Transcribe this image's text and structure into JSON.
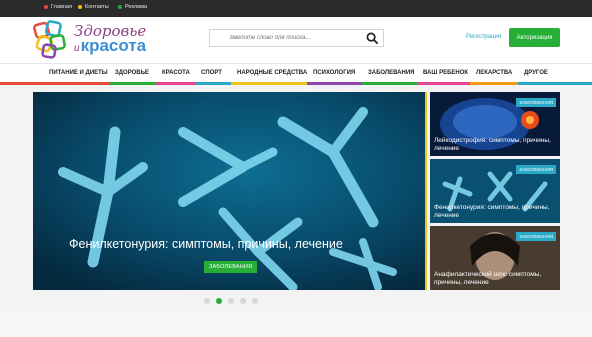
{
  "topbar": {
    "links": [
      {
        "label": "Главная",
        "color": "#e74c3c"
      },
      {
        "label": "Контакты",
        "color": "#f0c419"
      },
      {
        "label": "Реклама",
        "color": "#27ae37"
      }
    ]
  },
  "header": {
    "logo": {
      "word1": "Здоровье",
      "and": "и",
      "word2": "красота"
    },
    "search": {
      "placeholder": "Введите слово для поиска..."
    },
    "register_label": "Регистрация",
    "auth_label": "Авторизация"
  },
  "nav": {
    "items": [
      {
        "label": "ПИТАНИЕ И ДИЕТЫ",
        "color": "#e74c3c"
      },
      {
        "label": "ЗДОРОВЬЕ",
        "color": "#27ae37"
      },
      {
        "label": "КРАСОТА",
        "color": "#e84393"
      },
      {
        "label": "СПОРТ",
        "color": "#2aa9c6"
      },
      {
        "label": "НАРОДНЫЕ СРЕДСТВА",
        "color": "#f0c419"
      },
      {
        "label": "ПСИХОЛОГИЯ",
        "color": "#8e44ad"
      },
      {
        "label": "ЗАБОЛЕВАНИЯ",
        "color": "#27ae37"
      },
      {
        "label": "ВАШ РЕБЕНОК",
        "color": "#e84393"
      },
      {
        "label": "ЛЕКАРСТВА",
        "color": "#f39c12"
      },
      {
        "label": "ДРУГОЕ",
        "color": "#2aa9c6"
      }
    ]
  },
  "slider": {
    "main": {
      "title": "Фенилкетонурия: симптомы, причины, лечение",
      "tag": "ЗАБОЛЕВАНИЯ"
    },
    "side": [
      {
        "tag": "ЗАБОЛЕВАНИЯ",
        "caption": "Лейкодистрофия: симптомы, причины, лечение"
      },
      {
        "tag": "ЗАБОЛЕВАНИЯ",
        "caption": "Фенилкетонурия: симптомы, причины, лечение"
      },
      {
        "tag": "ЗАБОЛЕВАНИЯ",
        "caption": "Анафилактический шок: симптомы, причины, лечение"
      }
    ],
    "pagination": {
      "total": 5,
      "active_index": 1
    }
  },
  "colors": {
    "accent_green": "#27ae37",
    "accent_blue": "#2aa9c6",
    "topbar_bg": "#2b2b2b",
    "highlight_border": "#f0c419"
  }
}
